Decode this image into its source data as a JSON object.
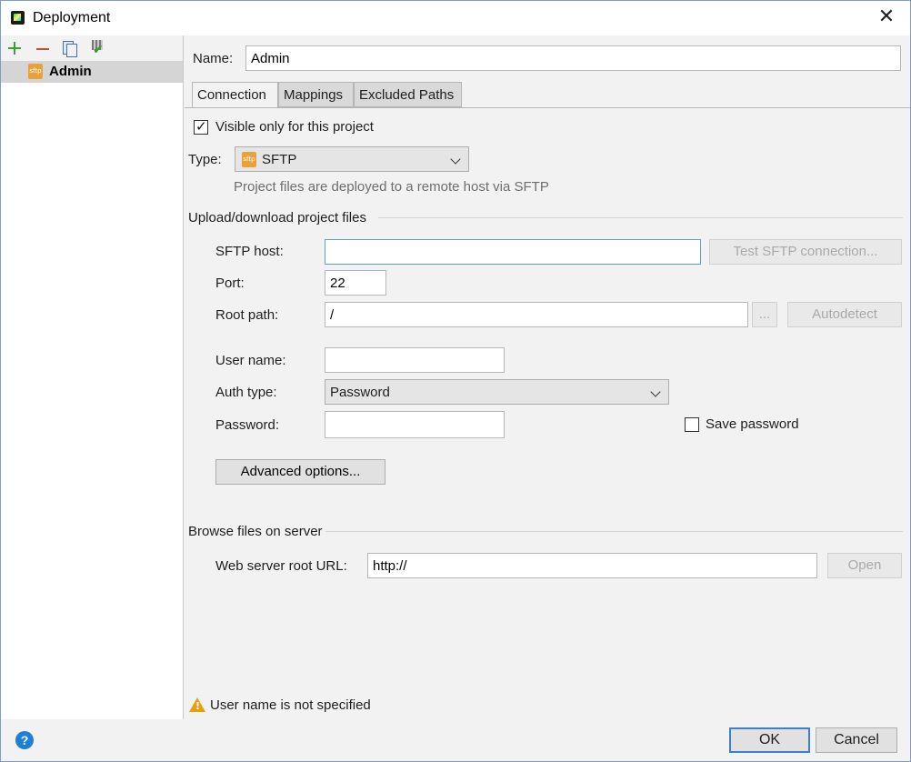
{
  "window": {
    "title": "Deployment",
    "close_glyph": "✕"
  },
  "toolbar": {
    "add_icon": "plus-icon",
    "remove_icon": "minus-icon",
    "copy_icon": "copy-icon",
    "use_default_icon": "checkmark-server-icon"
  },
  "tree": {
    "items": [
      {
        "label": "Admin",
        "icon": "sftp-icon",
        "icon_text": "sftp",
        "selected": true
      }
    ]
  },
  "server": {
    "name_label": "Name:",
    "name_value": "Admin"
  },
  "tabs": [
    {
      "label": "Connection",
      "active": true
    },
    {
      "label": "Mappings",
      "active": false
    },
    {
      "label": "Excluded Paths",
      "active": false
    }
  ],
  "connection": {
    "visible_only_label": "Visible only for this project",
    "visible_only_checked": true,
    "type_label": "Type:",
    "type_value": "SFTP",
    "type_icon_text": "sftp",
    "type_description": "Project files are deployed to a remote host via SFTP",
    "upload_section": "Upload/download project files",
    "sftp_host_label": "SFTP host:",
    "sftp_host_value": "",
    "test_button": "Test SFTP connection...",
    "port_label": "Port:",
    "port_value": "22",
    "root_path_label": "Root path:",
    "root_path_value": "/",
    "browse_button": "...",
    "autodetect_button": "Autodetect",
    "user_name_label": "User name:",
    "user_name_value": "",
    "auth_type_label": "Auth type:",
    "auth_type_value": "Password",
    "password_label": "Password:",
    "password_value": "",
    "save_password_label": "Save password",
    "save_password_checked": false,
    "advanced_button": "Advanced options...",
    "browse_section": "Browse files on server",
    "web_root_label": "Web server root URL:",
    "web_root_value": "http://",
    "open_button": "Open"
  },
  "status": {
    "warning_text": "User name is not specified",
    "warning_icon": "warning-icon"
  },
  "footer": {
    "help_glyph": "?",
    "ok_label": "OK",
    "cancel_label": "Cancel"
  },
  "colors": {
    "accent": "#3c7fd1",
    "selection": "#d5d5d5",
    "warning": "#e5a00d",
    "help": "#1e7fd6"
  }
}
